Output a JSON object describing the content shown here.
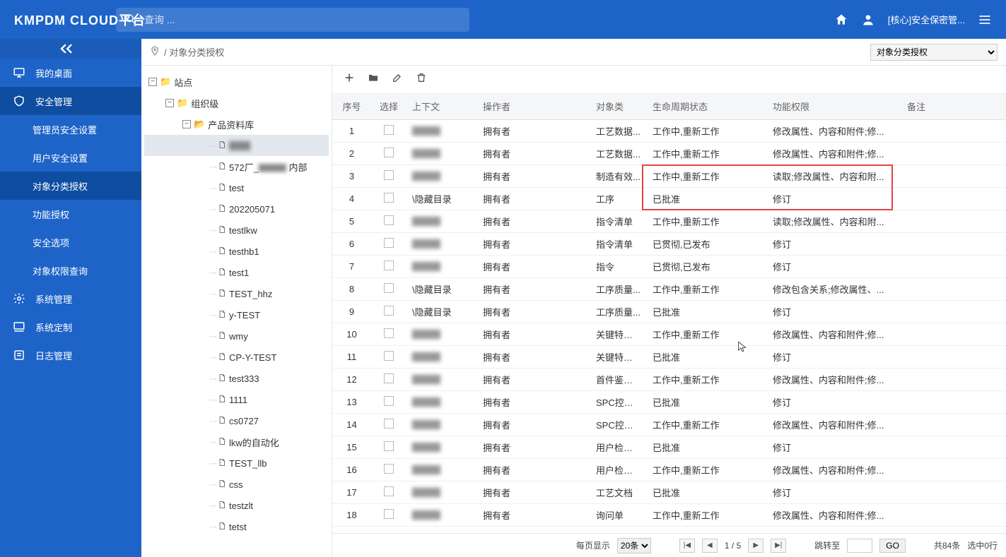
{
  "header": {
    "logo": "KMPDM CLOUD平台",
    "search_placeholder": "查询 ...",
    "user_label": "[核心]安全保密管..."
  },
  "sidebar": {
    "items": [
      {
        "label": "我的桌面",
        "icon": "desktop"
      },
      {
        "label": "安全管理",
        "icon": "shield",
        "active": true
      },
      {
        "label": "系统管理",
        "icon": "gear"
      },
      {
        "label": "系统定制",
        "icon": "monitor"
      },
      {
        "label": "日志管理",
        "icon": "list"
      }
    ],
    "sub_items": [
      {
        "label": "管理员安全设置"
      },
      {
        "label": "用户安全设置"
      },
      {
        "label": "对象分类授权",
        "active": true
      },
      {
        "label": "功能授权"
      },
      {
        "label": "安全选项"
      },
      {
        "label": "对象权限查询"
      }
    ]
  },
  "crumb": {
    "path_text": "/ 对象分类授权",
    "select_value": "对象分类授权"
  },
  "tree": {
    "root": "站点",
    "level2": "组织级",
    "level3": "产品资料库",
    "leaves": [
      {
        "label": "▇▇▇",
        "blur": true,
        "selected": true
      },
      {
        "label": "572厂_▇▇▇ 内部",
        "partial_blur": true
      },
      {
        "label": "test"
      },
      {
        "label": "202205071"
      },
      {
        "label": "testlkw"
      },
      {
        "label": "testhb1"
      },
      {
        "label": "test1"
      },
      {
        "label": "TEST_hhz"
      },
      {
        "label": "y-TEST"
      },
      {
        "label": "wmy"
      },
      {
        "label": "CP-Y-TEST"
      },
      {
        "label": "test333"
      },
      {
        "label": "1111"
      },
      {
        "label": "cs0727"
      },
      {
        "label": "lkw的自动化"
      },
      {
        "label": "TEST_llb"
      },
      {
        "label": "css"
      },
      {
        "label": "testzlt"
      },
      {
        "label": "tetst"
      }
    ]
  },
  "table": {
    "headers": [
      "序号",
      "选择",
      "上下文",
      "操作者",
      "对象类",
      "生命周期状态",
      "功能权限",
      "备注"
    ],
    "rows": [
      {
        "n": "1",
        "ctx_blur": true,
        "ctx": "",
        "op": "拥有者",
        "obj": "工艺数据...",
        "state": "工作中,重新工作",
        "perm": "修改属性、内容和附件;修...",
        "note": ""
      },
      {
        "n": "2",
        "ctx_blur": true,
        "ctx": "",
        "op": "拥有者",
        "obj": "工艺数据...",
        "state": "工作中,重新工作",
        "perm": "修改属性、内容和附件;修...",
        "note": ""
      },
      {
        "n": "3",
        "ctx_blur": true,
        "ctx": "",
        "op": "拥有者",
        "obj": "制造有效...",
        "state": "工作中,重新工作",
        "perm": "读取;修改属性、内容和附...",
        "note": ""
      },
      {
        "n": "4",
        "ctx": "\\隐藏目录",
        "op": "拥有者",
        "obj": "工序",
        "state": "已批准",
        "perm": "修订",
        "note": ""
      },
      {
        "n": "5",
        "ctx_blur": true,
        "ctx": "",
        "op": "拥有者",
        "obj": "指令清单",
        "state": "工作中,重新工作",
        "perm": "读取;修改属性、内容和附...",
        "note": ""
      },
      {
        "n": "6",
        "ctx_blur": true,
        "ctx": "",
        "op": "拥有者",
        "obj": "指令清单",
        "state": "已贯彻,已发布",
        "perm": "修订",
        "note": ""
      },
      {
        "n": "7",
        "ctx_blur": true,
        "ctx": "",
        "op": "拥有者",
        "obj": "指令",
        "state": "已贯彻,已发布",
        "perm": "修订",
        "note": ""
      },
      {
        "n": "8",
        "ctx": "\\隐藏目录",
        "op": "拥有者",
        "obj": "工序质量...",
        "state": "工作中,重新工作",
        "perm": "修改包含关系;修改属性、...",
        "note": ""
      },
      {
        "n": "9",
        "ctx": "\\隐藏目录",
        "op": "拥有者",
        "obj": "工序质量...",
        "state": "已批准",
        "perm": "修订",
        "note": ""
      },
      {
        "n": "10",
        "ctx_blur": true,
        "ctx": "",
        "op": "拥有者",
        "obj": "关键特性项",
        "state": "工作中,重新工作",
        "perm": "修改属性、内容和附件;修...",
        "note": ""
      },
      {
        "n": "11",
        "ctx_blur": true,
        "ctx": "",
        "op": "拥有者",
        "obj": "关键特性项",
        "state": "已批准",
        "perm": "修订",
        "note": ""
      },
      {
        "n": "12",
        "ctx_blur": true,
        "ctx": "",
        "op": "拥有者",
        "obj": "首件鉴定项",
        "state": "工作中,重新工作",
        "perm": "修改属性、内容和附件;修...",
        "note": ""
      },
      {
        "n": "13",
        "ctx_blur": true,
        "ctx": "",
        "op": "拥有者",
        "obj": "SPC控制项",
        "state": "已批准",
        "perm": "修订",
        "note": ""
      },
      {
        "n": "14",
        "ctx_blur": true,
        "ctx": "",
        "op": "拥有者",
        "obj": "SPC控制项",
        "state": "工作中,重新工作",
        "perm": "修改属性、内容和附件;修...",
        "note": ""
      },
      {
        "n": "15",
        "ctx_blur": true,
        "ctx": "",
        "op": "拥有者",
        "obj": "用户检验项",
        "state": "已批准",
        "perm": "修订",
        "note": ""
      },
      {
        "n": "16",
        "ctx_blur": true,
        "ctx": "",
        "op": "拥有者",
        "obj": "用户检验项",
        "state": "工作中,重新工作",
        "perm": "修改属性、内容和附件;修...",
        "note": ""
      },
      {
        "n": "17",
        "ctx_blur": true,
        "ctx": "",
        "op": "拥有者",
        "obj": "工艺文档",
        "state": "已批准",
        "perm": "修订",
        "note": ""
      },
      {
        "n": "18",
        "ctx_blur": true,
        "ctx": "",
        "op": "拥有者",
        "obj": "询问单",
        "state": "工作中,重新工作",
        "perm": "修改属性、内容和附件;修...",
        "note": ""
      }
    ]
  },
  "pager": {
    "per_label": "每页显示",
    "per_value": "20条",
    "page_text": "1 / 5",
    "goto_label": "跳转至",
    "go_label": "GO",
    "total_text": "共84条",
    "sel_text": "选中0行"
  }
}
